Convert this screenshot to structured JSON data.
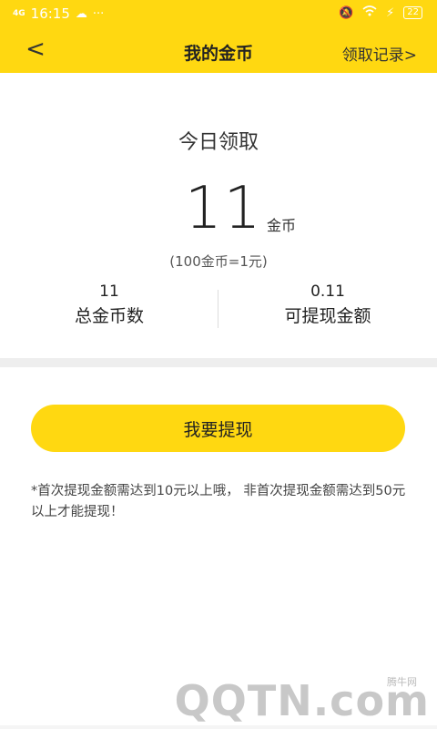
{
  "status": {
    "signal": "4G",
    "time": "16:15",
    "more": "···",
    "battery": "22"
  },
  "nav": {
    "back": "<",
    "title": "我的金币",
    "record": "领取记录>"
  },
  "today": {
    "label": "今日领取",
    "amount": "11",
    "unit": "金币",
    "rate": "(100金币=1元)"
  },
  "stats": {
    "total_value": "11",
    "total_label": "总金币数",
    "withdrawable_value": "0.11",
    "withdrawable_label": "可提现金额"
  },
  "withdraw_button": "我要提现",
  "tip": "*首次提现金额需达到10元以上哦， 非首次提现金额需达到50元以上才能提现！",
  "watermark": {
    "brand": "腾牛网",
    "logo": "QQTN.com"
  },
  "colors": {
    "accent": "#FFD811",
    "band": "#EEEEEE"
  }
}
